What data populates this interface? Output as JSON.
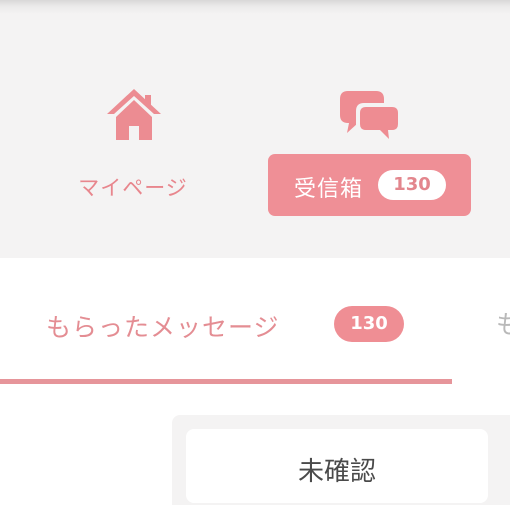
{
  "theme": {
    "accent": "#ef8f96",
    "nav_background": "#f4f3f3",
    "muted_text": "#b9b9b9",
    "dark_text": "#4a4a4a"
  },
  "nav": {
    "mypage": {
      "label": "マイページ",
      "icon": "home-icon"
    },
    "inbox": {
      "label": "受信箱",
      "count": "130",
      "icon": "chat-bubbles-icon",
      "selected": true
    }
  },
  "tabs": {
    "received": {
      "label": "もらったメッセージ",
      "count": "130",
      "selected": true
    },
    "next_partial": "も"
  },
  "filter": {
    "label": "未確認"
  }
}
